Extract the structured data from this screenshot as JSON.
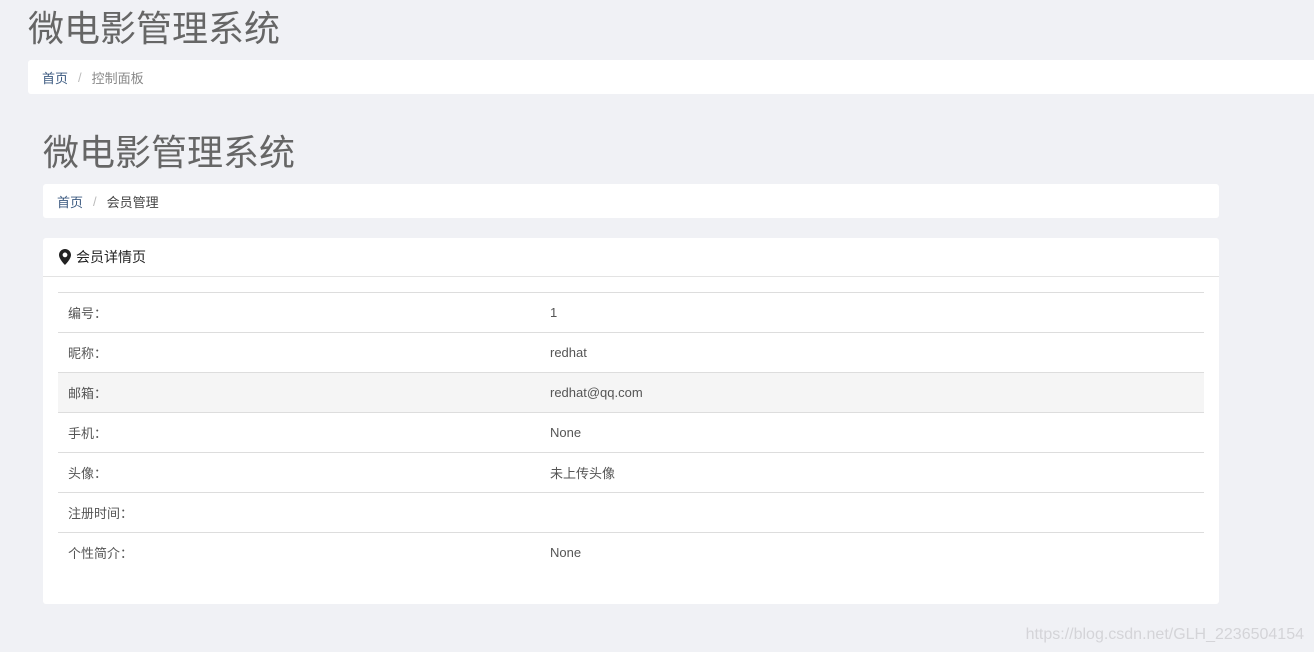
{
  "header": {
    "title": "微电影管理系统",
    "breadcrumb": {
      "home": "首页",
      "separator": "/",
      "current": "控制面板"
    }
  },
  "content": {
    "title": "微电影管理系统",
    "breadcrumb": {
      "home": "首页",
      "separator": "/",
      "current": "会员管理"
    },
    "box": {
      "icon": "map-marker-icon",
      "title": "会员详情页",
      "rows": [
        {
          "label": "编号：",
          "value": "1"
        },
        {
          "label": "昵称：",
          "value": "redhat"
        },
        {
          "label": "邮箱：",
          "value": "redhat@qq.com"
        },
        {
          "label": "手机：",
          "value": "None"
        },
        {
          "label": "头像：",
          "value": "未上传头像"
        },
        {
          "label": "注册时间：",
          "value": ""
        },
        {
          "label": "个性简介：",
          "value": "None"
        }
      ],
      "highlighted_row_index": 2
    }
  },
  "watermark": "https://blog.csdn.net/GLH_2236504154",
  "colors": {
    "background": "#f0f1f5",
    "link": "#3c5a80",
    "row_highlight": "#f5f5f5"
  }
}
